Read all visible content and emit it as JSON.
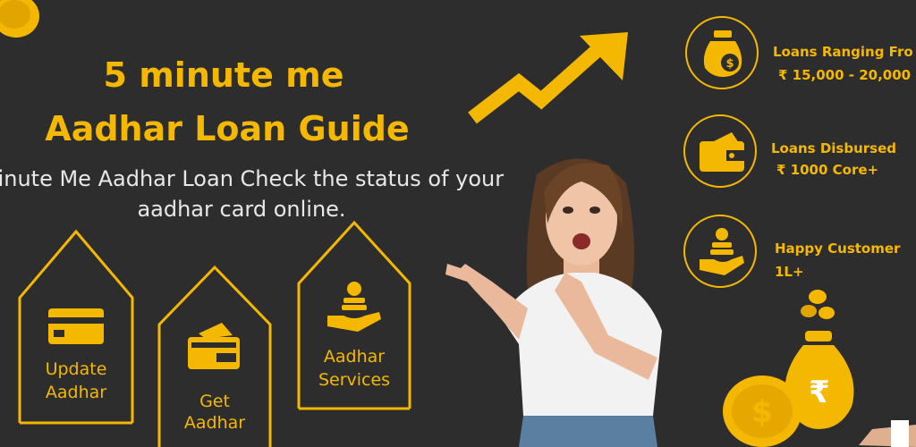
{
  "headline": {
    "line1": "5 minute me",
    "line2": "Aadhar Loan Guide"
  },
  "description": {
    "line1": "Minute Me Aadhar Loan Check the status of your",
    "line2": "aadhar card online."
  },
  "houses": [
    {
      "label_line1": "Update",
      "label_line2": "Aadhar",
      "icon": "credit-card-icon"
    },
    {
      "label_line1": "Get",
      "label_line2": "Aadhar",
      "icon": "wallet-card-icon"
    },
    {
      "label_line1": "Aadhar",
      "label_line2": "Services",
      "icon": "hand-coins-icon"
    }
  ],
  "stats": [
    {
      "title": "Loans Ranging Fro",
      "value": "₹ 15,000 - 20,000",
      "icon": "money-bag-icon"
    },
    {
      "title": "Loans Disbursed",
      "value": "₹ 1000 Core+",
      "icon": "wallet-icon"
    },
    {
      "title": "Happy Customer",
      "value": "1L+",
      "icon": "hand-coins-icon"
    }
  ],
  "colors": {
    "background": "#2d2d2d",
    "accent": "#f5b800",
    "text": "#e8e8e8"
  },
  "rupee_symbol": "₹",
  "dollar_symbol": "$"
}
